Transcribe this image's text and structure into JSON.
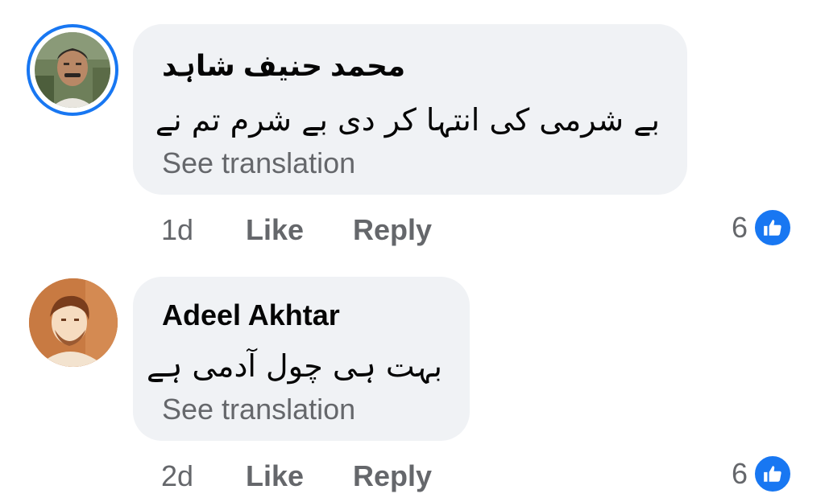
{
  "comments": [
    {
      "author": "محمد حنیف شاہد",
      "text": "بے شرمی کی انتہا کر دی بے شرم تم نے",
      "see_translation": "See translation",
      "time": "1d",
      "like_label": "Like",
      "reply_label": "Reply",
      "reaction_count": "6",
      "reaction_icon": "like-icon",
      "avatar": "profile-photo-man-mustache",
      "avatar_ring_color": "#1877f2"
    },
    {
      "author": "Adeel Akhtar",
      "text": "بہت ہی چول آدمی ہے",
      "see_translation": "See translation",
      "time": "2d",
      "like_label": "Like",
      "reply_label": "Reply",
      "reaction_count": "6",
      "reaction_icon": "like-icon",
      "avatar": "profile-photo-sepia-man"
    }
  ],
  "colors": {
    "bubble": "#f0f2f5",
    "secondary_text": "#65676b",
    "accent": "#1877f2"
  }
}
